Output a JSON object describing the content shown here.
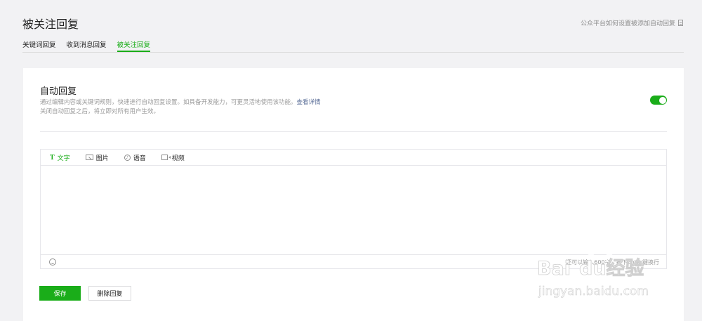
{
  "page": {
    "title": "被关注回复",
    "help_link": "公众平台如何设置被添加自动回复"
  },
  "tabs": [
    {
      "label": "关键词回复",
      "active": false
    },
    {
      "label": "收到消息回复",
      "active": false
    },
    {
      "label": "被关注回复",
      "active": true
    }
  ],
  "auto_reply": {
    "title": "自动回复",
    "desc_line1": "通过编辑内容或关键词规则，快速进行自动回复设置。如具备开发能力，可更灵活地使用该功能。",
    "more_link": "查看详情",
    "desc_line2": "关闭自动回复之后，将立即对所有用户生效。",
    "enabled": true
  },
  "editor": {
    "tabs": [
      {
        "label": "文字",
        "icon": "text-icon",
        "active": true
      },
      {
        "label": "图片",
        "icon": "image-icon",
        "active": false
      },
      {
        "label": "语音",
        "icon": "voice-icon",
        "active": false
      },
      {
        "label": "视频",
        "icon": "video-icon",
        "active": false
      }
    ],
    "content": "",
    "counter_text": "还可以输入600字，按下Enter键换行"
  },
  "buttons": {
    "save": "保存",
    "delete": "删除回复"
  },
  "watermark": {
    "brand": "Baidu经验",
    "url": "jingyan.baidu.com"
  },
  "colors": {
    "accent": "#1aad19",
    "link": "#576b95"
  }
}
